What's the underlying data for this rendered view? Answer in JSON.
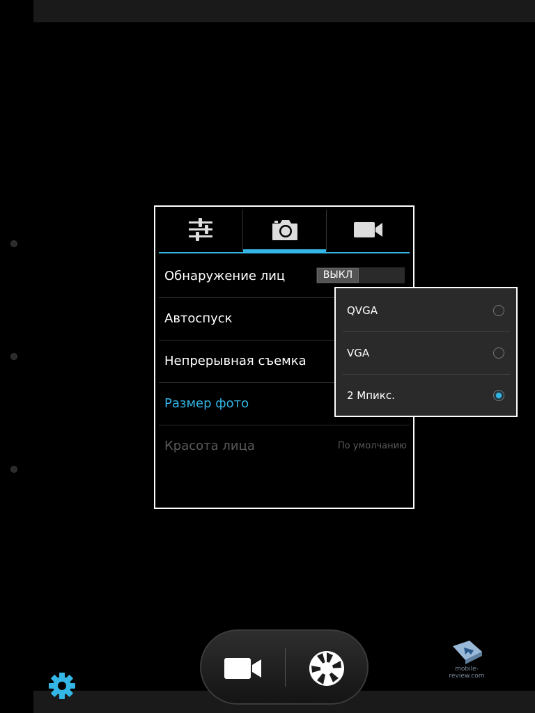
{
  "tabs": [
    {
      "name": "general-settings",
      "icon": "sliders-icon"
    },
    {
      "name": "photo-settings",
      "icon": "camera-icon",
      "active": true
    },
    {
      "name": "video-settings",
      "icon": "video-camera-icon"
    }
  ],
  "settings": {
    "face_detection": {
      "label": "Обнаружение лиц",
      "toggle": "ВЫКЛ"
    },
    "self_timer": {
      "label": "Автоспуск"
    },
    "burst": {
      "label": "Непрерывная съемка"
    },
    "photo_size": {
      "label": "Размер фото"
    },
    "face_beauty": {
      "label": "Красота лица",
      "value": "По умолчанию"
    }
  },
  "photo_size_popup": {
    "options": [
      {
        "label": "QVGA",
        "selected": false
      },
      {
        "label": "VGA",
        "selected": false
      },
      {
        "label": "2 Мпикс.",
        "selected": true
      }
    ]
  },
  "controls": {
    "video_icon": "video-camera-icon",
    "shutter_icon": "shutter-icon",
    "settings_icon": "gear-icon"
  },
  "watermark": {
    "text": "mobile-review.com"
  },
  "colors": {
    "accent": "#33b5e5",
    "panel_border": "#ffffff"
  }
}
